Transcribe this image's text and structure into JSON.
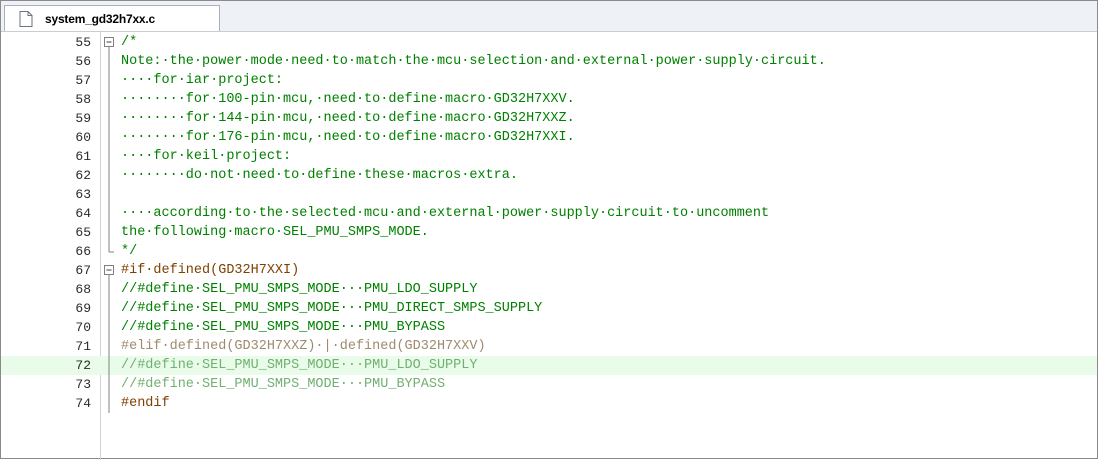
{
  "tab": {
    "filename": "system_gd32h7xx.c"
  },
  "lines": [
    {
      "n": "55",
      "text": "/*",
      "style": "comment",
      "fold": "open"
    },
    {
      "n": "56",
      "text": "Note:·the·power·mode·need·to·match·the·mcu·selection·and·external·power·supply·circuit.",
      "style": "comment",
      "fold": "bar"
    },
    {
      "n": "57",
      "text": "····for·iar·project:",
      "style": "comment",
      "fold": "bar"
    },
    {
      "n": "58",
      "text": "········for·100-pin·mcu,·need·to·define·macro·GD32H7XXV.",
      "style": "comment",
      "fold": "bar"
    },
    {
      "n": "59",
      "text": "········for·144-pin·mcu,·need·to·define·macro·GD32H7XXZ.",
      "style": "comment",
      "fold": "bar"
    },
    {
      "n": "60",
      "text": "········for·176-pin·mcu,·need·to·define·macro·GD32H7XXI.",
      "style": "comment",
      "fold": "bar"
    },
    {
      "n": "61",
      "text": "····for·keil·project:",
      "style": "comment",
      "fold": "bar"
    },
    {
      "n": "62",
      "text": "········do·not·need·to·define·these·macros·extra.",
      "style": "comment",
      "fold": "bar"
    },
    {
      "n": "63",
      "text": "",
      "style": "comment",
      "fold": "bar"
    },
    {
      "n": "64",
      "text": "····according·to·the·selected·mcu·and·external·power·supply·circuit·to·uncomment",
      "style": "comment",
      "fold": "bar"
    },
    {
      "n": "65",
      "text": "the·following·macro·SEL_PMU_SMPS_MODE.",
      "style": "comment",
      "fold": "bar"
    },
    {
      "n": "66",
      "text": "*/",
      "style": "comment",
      "fold": "end"
    },
    {
      "n": "67",
      "text": "#if·defined(GD32H7XXI)",
      "style": "pre",
      "fold": "open"
    },
    {
      "n": "68",
      "text": "//#define·SEL_PMU_SMPS_MODE···PMU_LDO_SUPPLY",
      "style": "comment",
      "fold": "bar"
    },
    {
      "n": "69",
      "text": "//#define·SEL_PMU_SMPS_MODE···PMU_DIRECT_SMPS_SUPPLY",
      "style": "comment",
      "fold": "bar"
    },
    {
      "n": "70",
      "text": "//#define·SEL_PMU_SMPS_MODE···PMU_BYPASS",
      "style": "comment",
      "fold": "bar"
    },
    {
      "n": "71",
      "text": "#elif·defined(GD32H7XXZ)·|·defined(GD32H7XXV)",
      "style": "pre-dim",
      "fold": "bar"
    },
    {
      "n": "72",
      "text": "//#define·SEL_PMU_SMPS_MODE···PMU_LDO_SUPPLY",
      "style": "comment-dim",
      "fold": "bar",
      "highlight": true
    },
    {
      "n": "73",
      "text": "//#define·SEL_PMU_SMPS_MODE···PMU_BYPASS",
      "style": "comment-dim",
      "fold": "bar"
    },
    {
      "n": "74",
      "text": "#endif",
      "style": "pre",
      "fold": "bar"
    }
  ],
  "colors": {
    "comment": "#008000",
    "preprocessor": "#804000",
    "highlight_line": "#e9fbe9"
  }
}
